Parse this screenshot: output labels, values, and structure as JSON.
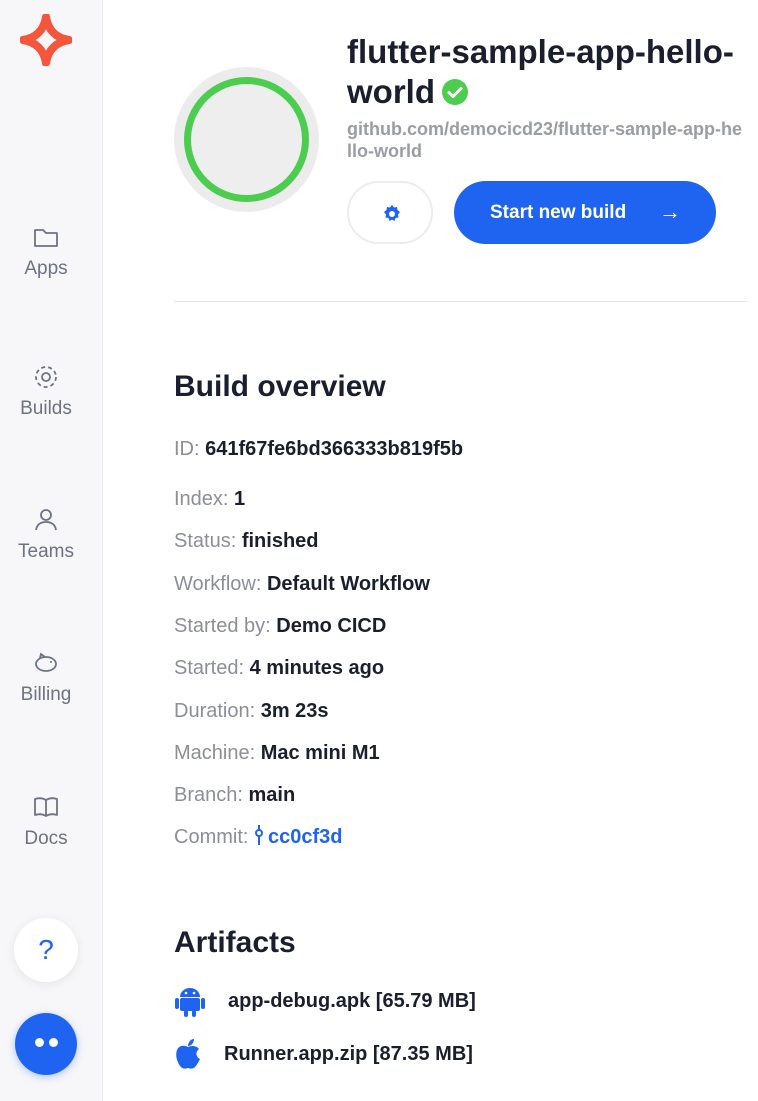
{
  "sidebar": {
    "items": [
      {
        "label": "Apps",
        "icon": "folder-icon"
      },
      {
        "label": "Builds",
        "icon": "builds-icon"
      },
      {
        "label": "Teams",
        "icon": "user-icon"
      },
      {
        "label": "Billing",
        "icon": "piggy-bank-icon"
      },
      {
        "label": "Docs",
        "icon": "book-icon"
      }
    ],
    "help_label": "?"
  },
  "app": {
    "title": "flutter-sample-app-hello-world",
    "repo_url": "github.com/democicd23/flutter-sample-app-hello-world",
    "start_build_label": "Start new build",
    "start_build_arrow": "→"
  },
  "overview": {
    "title": "Build overview",
    "fields": [
      {
        "key": "ID:",
        "value": "641f67fe6bd366333b819f5b"
      },
      {
        "key": "Index:",
        "value": "1"
      },
      {
        "key": "Status:",
        "value": "finished"
      },
      {
        "key": "Workflow:",
        "value": "Default Workflow"
      },
      {
        "key": "Started by:",
        "value": "Demo CICD"
      },
      {
        "key": "Started:",
        "value": "4 minutes ago"
      },
      {
        "key": "Duration:",
        "value": "3m 23s"
      },
      {
        "key": "Machine:",
        "value": "Mac mini M1"
      },
      {
        "key": "Branch:",
        "value": "main"
      },
      {
        "key": "Commit:",
        "value": "cc0cf3d"
      }
    ]
  },
  "artifacts": {
    "title": "Artifacts",
    "items": [
      {
        "name": "app-debug.apk [65.79 MB]",
        "icon": "android-icon"
      },
      {
        "name": "Runner.app.zip [87.35 MB]",
        "icon": "apple-icon"
      }
    ]
  },
  "colors": {
    "accent": "#1f64f0",
    "logo": "#f4553b",
    "success": "#4ccd4f"
  }
}
